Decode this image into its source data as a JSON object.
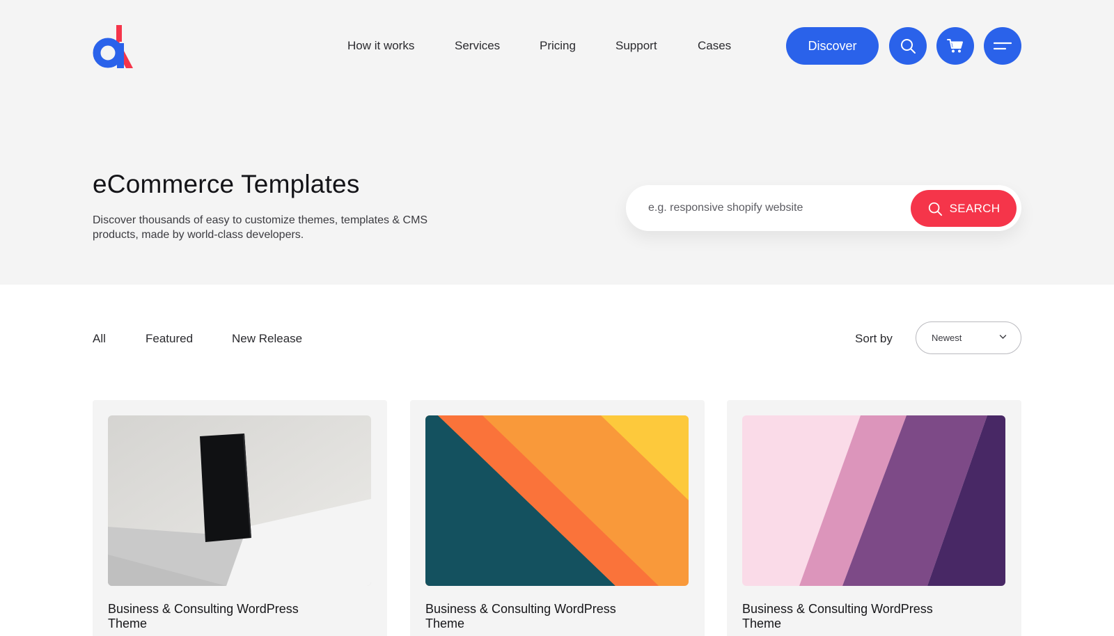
{
  "nav": {
    "links": [
      "How it works",
      "Services",
      "Pricing",
      "Support",
      "Cases"
    ],
    "discover_label": "Discover"
  },
  "icons": {
    "logo": "brand-logo",
    "search": "search-icon",
    "cart": "cart-icon",
    "menu": "menu-icon",
    "chevron": "chevron-down-icon"
  },
  "hero": {
    "title": "eCommerce Templates",
    "description": "Discover thousands of easy to customize themes, templates & CMS products, made by world-class developers.",
    "search_placeholder": "e.g. responsive shopify website",
    "search_button": "SEARCH"
  },
  "filters": {
    "tabs": [
      "All",
      "Featured",
      "New Release"
    ],
    "sort_label": "Sort by",
    "sort_value": "Newest"
  },
  "cards": [
    {
      "title": "Business & Consulting WordPress Theme"
    },
    {
      "title": "Business & Consulting WordPress Theme"
    },
    {
      "title": "Business & Consulting WordPress Theme"
    }
  ],
  "colors": {
    "primary": "#2a62ea",
    "accent": "#f5354a",
    "hero_bg": "#f4f4f4"
  }
}
